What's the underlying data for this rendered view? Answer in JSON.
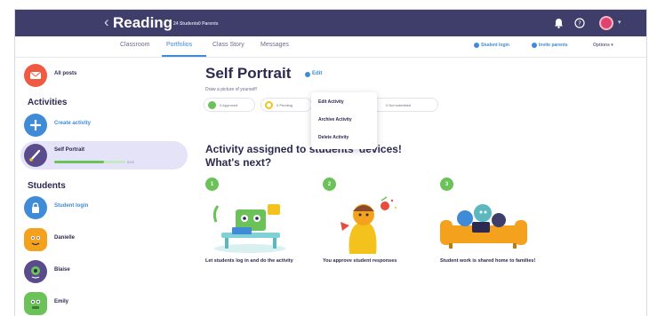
{
  "topbar": {
    "back_glyph": "‹",
    "title": "Reading",
    "students": "24 Students",
    "parents": "0 Parents",
    "icons": [
      "bell-icon",
      "help-icon",
      "avatar",
      "chevron-down-icon"
    ],
    "caret": "▾"
  },
  "subnav": {
    "tabs": [
      {
        "label": "Classroom"
      },
      {
        "label": "Portfolios"
      },
      {
        "label": "Class Story"
      },
      {
        "label": "Messages"
      }
    ],
    "active_tab": "Portfolios",
    "student_login": "Student login",
    "invite_parents": "Invite parents",
    "options": "Options ▾"
  },
  "sidebar": {
    "all_posts": "All posts",
    "activities_heading": "Activities",
    "create_activity": "Create activity",
    "self_portrait": "Self Portrait",
    "self_portrait_progress": 0.7,
    "self_portrait_progress_text": "0/24",
    "students_heading": "Students",
    "student_login": "Student login",
    "students": [
      {
        "name": "Danielle",
        "color": "#f4a21d"
      },
      {
        "name": "Blaise",
        "color": "#5a4b8c"
      },
      {
        "name": "Emily",
        "color": "#6ac259"
      }
    ]
  },
  "main": {
    "title": "Self Portrait",
    "edit": "Edit",
    "instructions": "Draw a picture of yourself!",
    "pills": [
      {
        "label": "0 Approved",
        "color": "#6ac259"
      },
      {
        "label": "0 Pending",
        "color": "#f4c21d"
      },
      {
        "label": "0 Not submitted",
        "color": "#cfcfdc"
      }
    ],
    "dropdown": [
      "Edit Activity",
      "Archive Activity",
      "Delete Activity"
    ],
    "assigned": "Activity assigned to students' devices!",
    "next": "What's next?",
    "steps": [
      {
        "num": "1",
        "caption": "Let students log in and do the activity"
      },
      {
        "num": "2",
        "caption": "You approve student responses"
      },
      {
        "num": "3",
        "caption": "Student work is shared home to families!"
      }
    ]
  },
  "colors": {
    "topbar": "#3f3e6a",
    "accent": "#3f8bd8",
    "green": "#6ac259",
    "selected": "#e4e3f7"
  }
}
